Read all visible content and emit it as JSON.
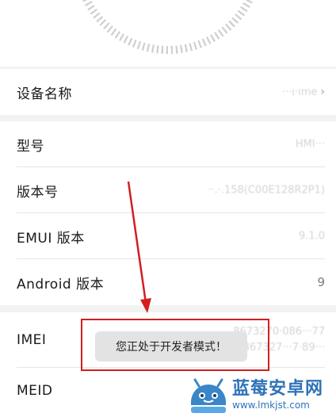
{
  "device_info": {
    "device_name": {
      "label": "设备名称",
      "value": "···ı·ıme",
      "chevron": "›"
    },
    "model": {
      "label": "型号",
      "value": "HMI···"
    },
    "build_number": {
      "label": "版本号",
      "value": "··.·.158(C00E128R2P1)"
    },
    "emui_version": {
      "label": "EMUI 版本",
      "value": "9.1.0"
    },
    "android_version": {
      "label": "Android 版本",
      "value": "9"
    },
    "imei": {
      "label": "IMEI",
      "value_1": "8673270·086···77",
      "value_2": "867327···7·89···"
    },
    "meid": {
      "label": "MEID",
      "value": ""
    }
  },
  "toast": {
    "text": "您正处于开发者模式！"
  },
  "watermark": {
    "title": "蓝莓安卓网",
    "url": "www.lmkjst.com"
  },
  "colors": {
    "annotation_red": "#d11f1f",
    "watermark_blue": "#2f73b8"
  }
}
